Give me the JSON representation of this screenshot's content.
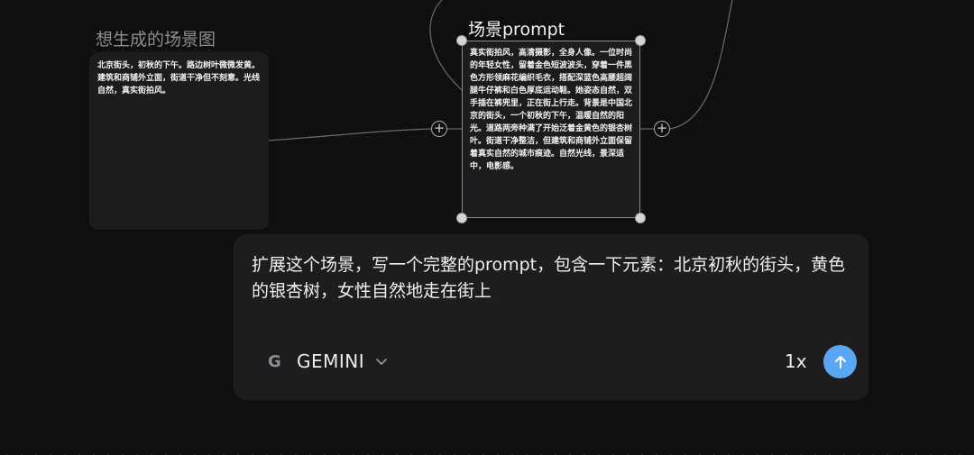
{
  "nodes": {
    "source": {
      "title": "想生成的场景图",
      "text": "北京街头，初秋的下午。路边树叶微微发黄。建筑和商铺外立面，街道干净但不刻意。光线自然，真实街拍风。"
    },
    "prompt": {
      "title": "场景prompt",
      "text": "真实街拍风，高清摄影，全身人像。一位时尚的年轻女性，留着金色短波波头，穿着一件黑色方形领麻花编织毛衣，搭配深蓝色高腰超阔腿牛仔裤和白色厚底运动鞋。她姿态自然，双手插在裤兜里，正在街上行走。背景是中国北京的街头，一个初秋的下午，温暖自然的阳光。道路两旁种满了开始泛着金黄色的银杏树叶。街道干净整洁，但建筑和商铺外立面保留着真实自然的城市痕迹。自然光线，景深适中，电影感。"
    }
  },
  "ports": {
    "plus_symbol": "+"
  },
  "composer": {
    "prompt_text": "扩展这个场景，写一个完整的prompt，包含一下元素：北京初秋的街头，黄色的银杏树，女性自然地走在街上",
    "model": {
      "icon": "google-g-icon",
      "icon_glyph": "G",
      "label": "GEMINI"
    },
    "count_label": "1x",
    "send_color": "#5aa6f5"
  }
}
